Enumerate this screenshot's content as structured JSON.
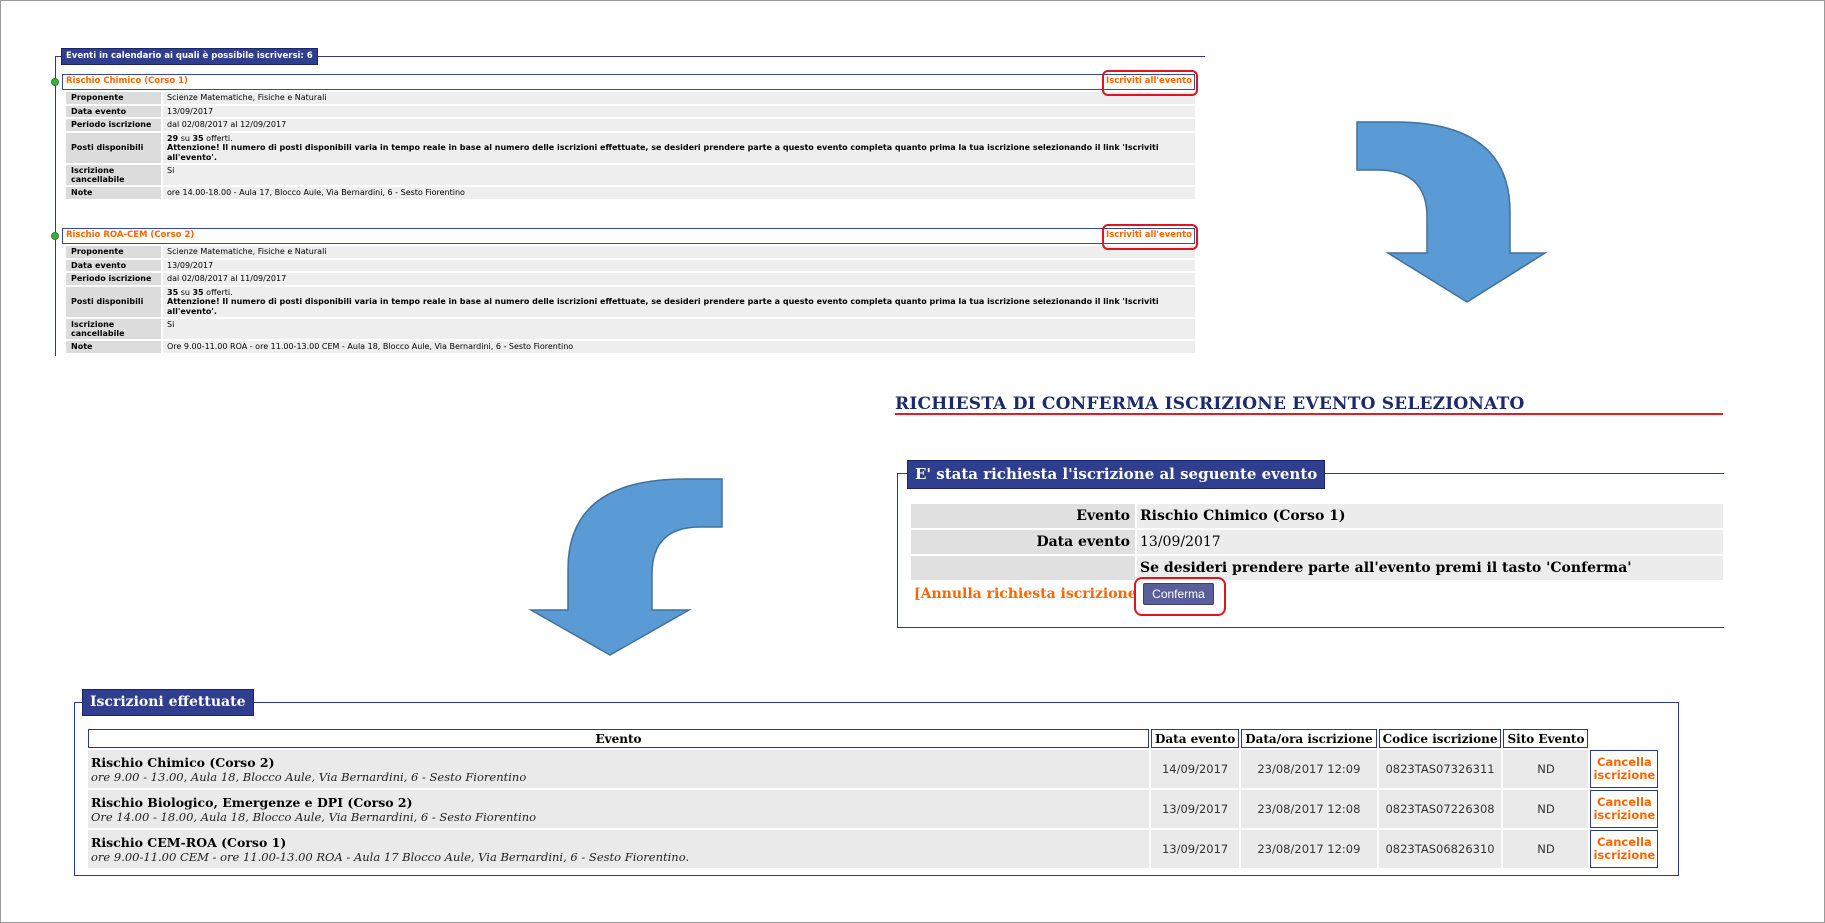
{
  "calendar": {
    "legend": "Eventi in calendario ai quali è possibile iscriversi: 6",
    "events": [
      {
        "title": "Rischio Chimico (Corso 1)",
        "link": "Iscriviti all'evento",
        "rows": [
          {
            "label": "Proponente",
            "value": "Scienze Matematiche, Fisiche e Naturali"
          },
          {
            "label": "Data evento",
            "value": "13/09/2017"
          },
          {
            "label": "Periodo iscrizione",
            "value": "dal 02/08/2017 al 12/09/2017"
          },
          {
            "label": "Posti disponibili",
            "posti_num": "29",
            "posti_su": "su",
            "posti_tot": "35",
            "posti_suffix": "offerti.",
            "warning": "Attenzione! Il numero di posti disponibili varia in tempo reale in base al numero delle iscrizioni effettuate, se desideri prendere parte a questo evento completa quanto prima la tua iscrizione selezionando il link 'Iscriviti all'evento'."
          },
          {
            "label": "Iscrizione cancellabile",
            "value": "Si"
          },
          {
            "label": "Note",
            "value": "ore 14.00-18.00 - Aula 17, Blocco Aule, Via Bernardini, 6 - Sesto Fiorentino"
          }
        ]
      },
      {
        "title": "Rischio ROA-CEM (Corso 2)",
        "link": "Iscriviti all'evento",
        "rows": [
          {
            "label": "Proponente",
            "value": "Scienze Matematiche, Fisiche e Naturali"
          },
          {
            "label": "Data evento",
            "value": "13/09/2017"
          },
          {
            "label": "Periodo iscrizione",
            "value": "dal 02/08/2017 al 11/09/2017"
          },
          {
            "label": "Posti disponibili",
            "posti_num": "35",
            "posti_su": "su",
            "posti_tot": "35",
            "posti_suffix": "offerti.",
            "warning": "Attenzione! Il numero di posti disponibili varia in tempo reale in base al numero delle iscrizioni effettuate, se desideri prendere parte a questo evento completa quanto prima la tua iscrizione selezionando il link 'Iscriviti all'evento'."
          },
          {
            "label": "Iscrizione cancellabile",
            "value": "Si"
          },
          {
            "label": "Note",
            "value": "Ore 9.00-11.00 ROA - ore 11.00-13.00 CEM - Aula 18, Blocco Aule, Via Bernardini, 6 - Sesto Fiorentino"
          }
        ]
      }
    ]
  },
  "confirm": {
    "title": "RICHIESTA DI CONFERMA ISCRIZIONE EVENTO SELEZIONATO",
    "legend": "E' stata richiesta l'iscrizione al seguente evento",
    "rows": [
      {
        "label": "Evento",
        "value": "Rischio Chimico (Corso 1)"
      },
      {
        "label": "Data evento",
        "value": "13/09/2017"
      },
      {
        "label": "",
        "value": "Se desideri prendere parte all'evento premi il tasto 'Conferma'"
      }
    ],
    "cancel_bracket": "[",
    "cancel_label": "Annulla richiesta iscrizione",
    "confirm_button": "Conferma"
  },
  "registrations": {
    "legend": "Iscrizioni effettuate",
    "columns": [
      "Evento",
      "Data evento",
      "Data/ora iscrizione",
      "Codice iscrizione",
      "Sito Evento"
    ],
    "rows": [
      {
        "name": "Rischio Chimico (Corso 2)",
        "desc": "ore 9.00 - 13.00, Aula 18, Blocco Aule, Via Bernardini, 6 - Sesto Fiorentino",
        "date": "14/09/2017",
        "reg_time": "23/08/2017 12:09",
        "code": "0823TAS07326311",
        "site": "ND",
        "cancel_l1": "Cancella",
        "cancel_l2": "iscrizione"
      },
      {
        "name": "Rischio Biologico, Emergenze e DPI (Corso 2)",
        "desc": "Ore 14.00 - 18.00, Aula 18, Blocco Aule, Via Bernardini, 6 - Sesto Fiorentino",
        "date": "13/09/2017",
        "reg_time": "23/08/2017 12:08",
        "code": "0823TAS07226308",
        "site": "ND",
        "cancel_l1": "Cancella",
        "cancel_l2": "iscrizione"
      },
      {
        "name": "Rischio CEM-ROA (Corso 1)",
        "desc": "ore 9.00-11.00 CEM - ore 11.00-13.00 ROA - Aula 17 Blocco Aule, Via Bernardini, 6 - Sesto Fiorentino.",
        "date": "13/09/2017",
        "reg_time": "23/08/2017 12:09",
        "code": "0823TAS06826310",
        "site": "ND",
        "cancel_l1": "Cancella",
        "cancel_l2": "iscrizione"
      }
    ]
  },
  "colors": {
    "accent_orange": "#ff6600",
    "legend_blue": "#2f3e8f",
    "highlight_red": "#e0141e",
    "arrow_blue": "#5b9bd5"
  }
}
